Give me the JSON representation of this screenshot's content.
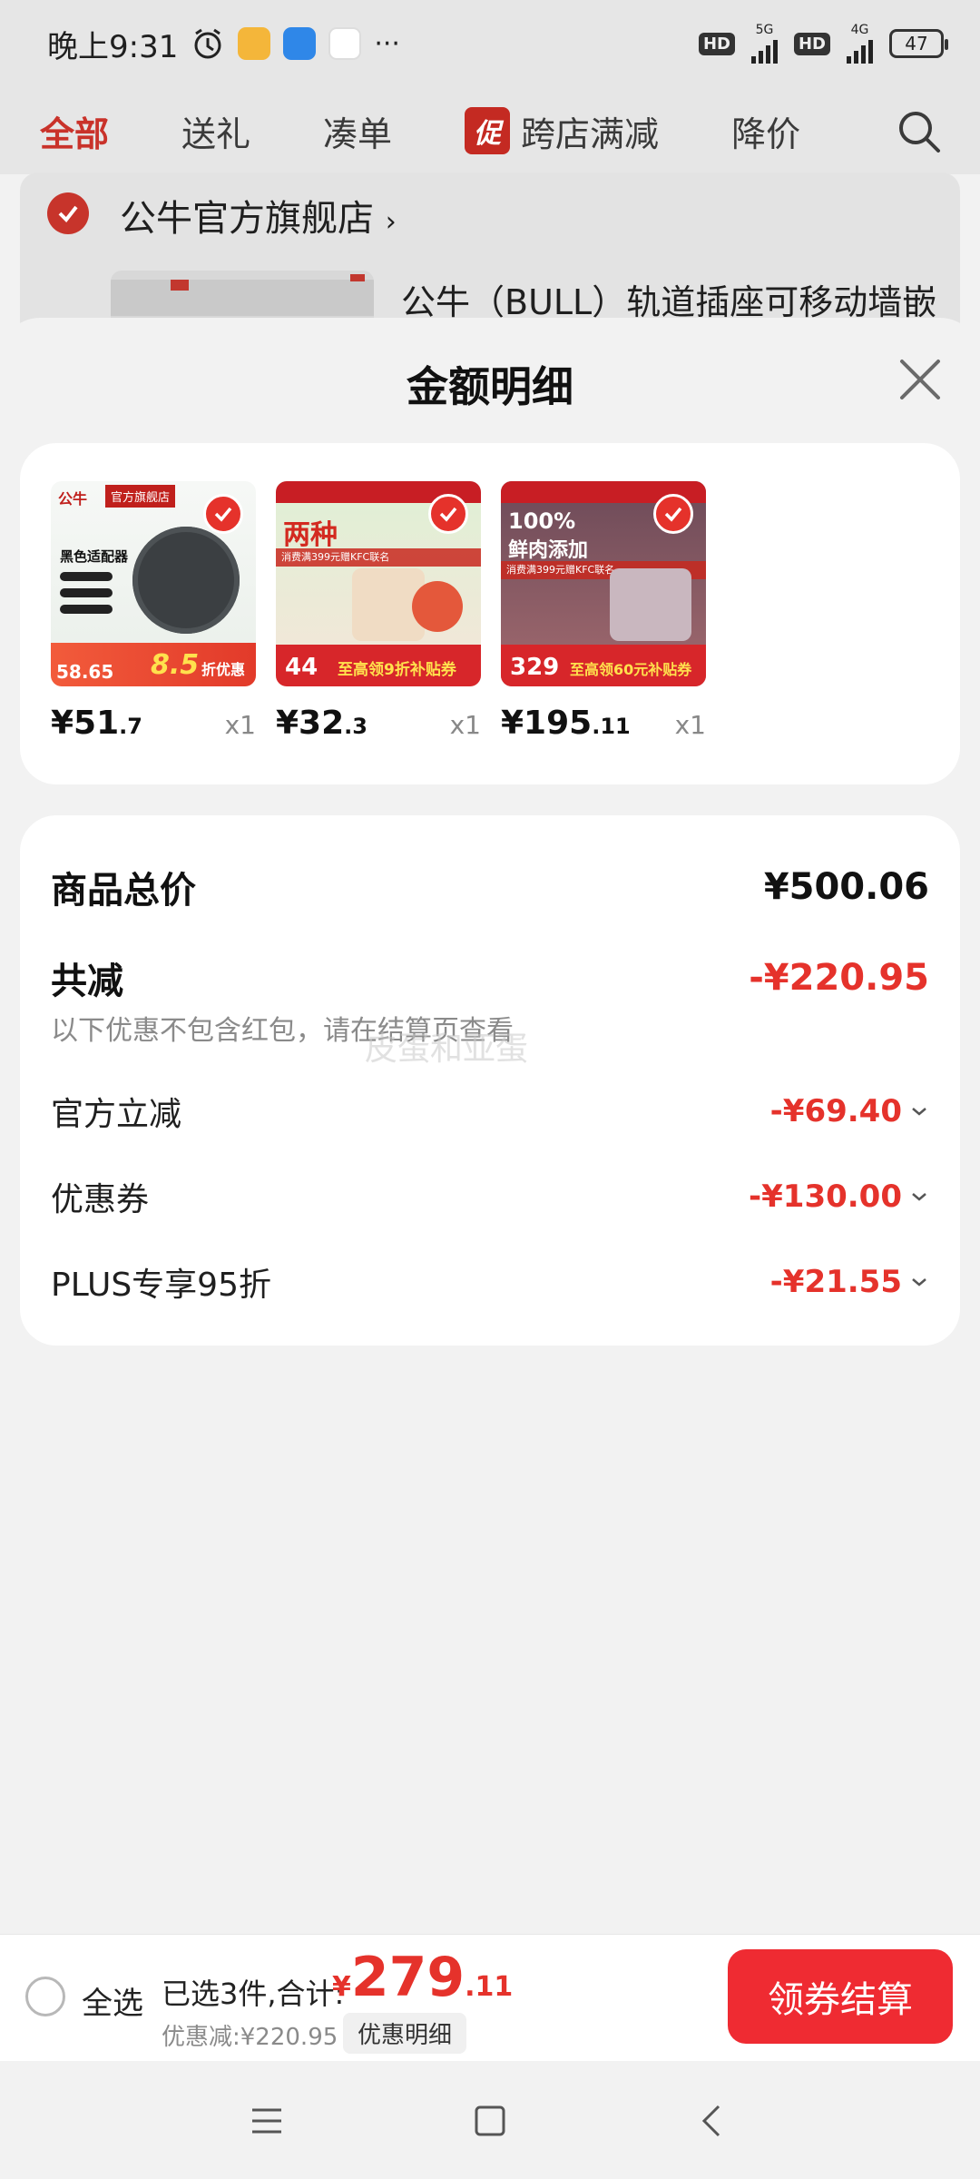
{
  "status_bar": {
    "time": "晚上9:31",
    "hd1": "HD",
    "net1": "5G",
    "hd2": "HD",
    "net2": "4G",
    "battery": "47"
  },
  "tabs": {
    "all": "全部",
    "gift": "送礼",
    "bundle": "凑单",
    "promo_badge": "促",
    "cross_store": "跨店满减",
    "price_drop": "降价"
  },
  "store": {
    "name": "公牛官方旗舰店",
    "product_title": "公牛（BULL）轨道插座可移动墙嵌"
  },
  "sheet": {
    "title": "金额明细",
    "products": [
      {
        "price_int": "¥51",
        "price_dec": ".7",
        "qty": "x1"
      },
      {
        "price_int": "¥32",
        "price_dec": ".3",
        "qty": "x1"
      },
      {
        "price_int": "¥195",
        "price_dec": ".11",
        "qty": "x1"
      }
    ],
    "product_images": [
      {
        "brand": "公牛",
        "badge": "官方旗舰店",
        "headline": "黑色适配器",
        "promo": "8.5",
        "promo_suffix": "折优惠",
        "price": "58.65"
      },
      {
        "headline": "两种",
        "promo_line": "消费满399元赠KFC联名",
        "bottom_price": "44",
        "coupon": "至高领9折补贴券"
      },
      {
        "headline": "100%",
        "headline2": "鲜肉添加",
        "promo_line": "消费满399元赠KFC联名",
        "bottom_price": "329",
        "coupon": "至高领60元补贴券"
      }
    ],
    "subtotal_label": "商品总价",
    "subtotal_value": "¥500.06",
    "reduction_label": "共减",
    "reduction_value": "-¥220.95",
    "note": "以下优惠不包含红包，请在结算页查看",
    "watermark": "皮蛋和亚蛋",
    "discounts": [
      {
        "label": "官方立减",
        "value": "-¥69.40"
      },
      {
        "label": "优惠券",
        "value": "-¥130.00"
      },
      {
        "label": "PLUS专享95折",
        "value": "-¥21.55"
      }
    ]
  },
  "checkout": {
    "select_all": "全选",
    "selected_text": "已选3件,合计:",
    "total_currency": "¥",
    "total_int": "279",
    "total_dec": ".11",
    "discount_text": "优惠减:¥220.95",
    "detail_button": "优惠明细",
    "pay_button": "领券结算"
  },
  "colors": {
    "accent_red": "#e5322b",
    "pay_button": "#ef2b32"
  }
}
